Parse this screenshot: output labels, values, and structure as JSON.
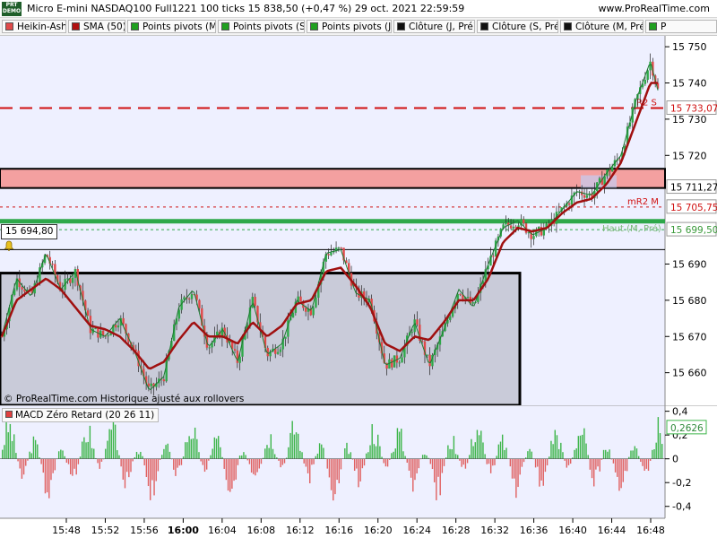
{
  "header": {
    "badge_line1": "PRT",
    "badge_line2": "DEMO",
    "title": "Micro E-mini NASDAQ100 Full1221 100 ticks 15 838,50 (+0,47 %) 29 oct. 2021 22:59:59",
    "site": "www.ProRealTime.com"
  },
  "legend": [
    {
      "label": "Heikin-Ashi",
      "color": "#e04a4a"
    },
    {
      "label": "SMA (50)",
      "color": "#b01010"
    },
    {
      "label": "Points pivots (M)",
      "color": "#20a020"
    },
    {
      "label": "Points pivots (S)",
      "color": "#20a020"
    },
    {
      "label": "Points pivots (J)",
      "color": "#20a020"
    },
    {
      "label": "Clôture (J, Pré)",
      "color": "#111111"
    },
    {
      "label": "Clôture (S, Pré)",
      "color": "#111111"
    },
    {
      "label": "Clôture (M, Pré)",
      "color": "#111111"
    },
    {
      "label": "P",
      "color": "#20a020"
    }
  ],
  "notes": {
    "copyright": "© ProRealTime.com  Historique ajusté aux rollovers",
    "left_price": "15 694,80"
  },
  "price_labels": {
    "r2s": {
      "text": "15 733,07",
      "level": 15733.07,
      "tag": "R2 S"
    },
    "upper_zone": {
      "text": "15 711,27",
      "level": 15711.27
    },
    "mr2m": {
      "text": "15 705,75",
      "level": 15705.75,
      "tag": "mR2 M"
    },
    "haut": {
      "text": "15 699,50",
      "level": 15699.5,
      "tag": "Haut (M, Pré)"
    },
    "last": {
      "text": "15 740",
      "level": 15740
    }
  },
  "macd": {
    "legend": "MACD Zéro Retard (20 26 11)",
    "value_label": "0,2626",
    "value": 0.2626
  },
  "colors": {
    "bull": "#2fa84a",
    "bear": "#e04848",
    "sma": "#a01010",
    "zone_fill": "#c9cbd9",
    "red_zone": "#f4a0a0",
    "pivot_green": "#2ea84a",
    "macd_pos": "#3db54a",
    "macd_neg": "#e06060",
    "bg": "#eef0ff"
  },
  "chart_data": {
    "type": "line",
    "title": "Micro E-mini NASDAQ100 Full1221 100 ticks",
    "y_ticks": [
      {
        "label": "15 750",
        "value": 15750
      },
      {
        "label": "15 740",
        "value": 15740
      },
      {
        "label": "15 730",
        "value": 15730
      },
      {
        "label": "15 720",
        "value": 15720
      },
      {
        "label": "15 690",
        "value": 15690
      },
      {
        "label": "15 680",
        "value": 15680
      },
      {
        "label": "15 670",
        "value": 15670
      },
      {
        "label": "15 660",
        "value": 15660
      }
    ],
    "x_ticks": [
      "15:48",
      "15:52",
      "15:56",
      "16:00",
      "16:04",
      "16:08",
      "16:12",
      "16:16",
      "16:20",
      "16:24",
      "16:28",
      "16:32",
      "16:36",
      "16:40",
      "16:44",
      "16:48"
    ],
    "macd_ticks": [
      {
        "label": "0,4",
        "value": 0.4
      },
      {
        "label": "0,2",
        "value": 0.2
      },
      {
        "label": "0",
        "value": 0
      },
      {
        "label": "-0,2",
        "value": -0.2
      },
      {
        "label": "-0,4",
        "value": -0.4
      }
    ],
    "ylim": [
      15651,
      15753
    ],
    "macd_ylim": [
      -0.5,
      0.45
    ],
    "price_path": [
      [
        0,
        15670
      ],
      [
        2,
        15686
      ],
      [
        4,
        15681
      ],
      [
        6,
        15693
      ],
      [
        8,
        15683
      ],
      [
        10,
        15688
      ],
      [
        12,
        15672
      ],
      [
        14,
        15670
      ],
      [
        16,
        15675
      ],
      [
        18,
        15666
      ],
      [
        20,
        15655
      ],
      [
        22,
        15659
      ],
      [
        24,
        15678
      ],
      [
        26,
        15683
      ],
      [
        28,
        15667
      ],
      [
        30,
        15672
      ],
      [
        32,
        15663
      ],
      [
        34,
        15680
      ],
      [
        36,
        15665
      ],
      [
        38,
        15668
      ],
      [
        40,
        15680
      ],
      [
        42,
        15677
      ],
      [
        44,
        15693
      ],
      [
        46,
        15694
      ],
      [
        48,
        15682
      ],
      [
        50,
        15680
      ],
      [
        52,
        15662
      ],
      [
        54,
        15664
      ],
      [
        56,
        15674
      ],
      [
        58,
        15662
      ],
      [
        60,
        15672
      ],
      [
        62,
        15683
      ],
      [
        64,
        15678
      ],
      [
        66,
        15690
      ],
      [
        68,
        15700
      ],
      [
        70,
        15702
      ],
      [
        72,
        15698
      ],
      [
        74,
        15700
      ],
      [
        76,
        15705
      ],
      [
        78,
        15710
      ],
      [
        80,
        15709
      ],
      [
        82,
        15715
      ],
      [
        84,
        15720
      ],
      [
        86,
        15735
      ],
      [
        88,
        15746
      ],
      [
        89,
        15738
      ]
    ],
    "sma_path": [
      [
        0,
        15670
      ],
      [
        2,
        15680
      ],
      [
        4,
        15683
      ],
      [
        6,
        15686
      ],
      [
        8,
        15683
      ],
      [
        10,
        15678
      ],
      [
        12,
        15673
      ],
      [
        14,
        15672
      ],
      [
        16,
        15670
      ],
      [
        18,
        15666
      ],
      [
        20,
        15661
      ],
      [
        22,
        15663
      ],
      [
        24,
        15669
      ],
      [
        26,
        15674
      ],
      [
        28,
        15670
      ],
      [
        30,
        15670
      ],
      [
        32,
        15668
      ],
      [
        34,
        15674
      ],
      [
        36,
        15670
      ],
      [
        38,
        15673
      ],
      [
        40,
        15679
      ],
      [
        42,
        15680
      ],
      [
        44,
        15688
      ],
      [
        46,
        15689
      ],
      [
        48,
        15684
      ],
      [
        50,
        15678
      ],
      [
        52,
        15668
      ],
      [
        54,
        15666
      ],
      [
        56,
        15670
      ],
      [
        58,
        15669
      ],
      [
        60,
        15674
      ],
      [
        62,
        15680
      ],
      [
        64,
        15680
      ],
      [
        66,
        15686
      ],
      [
        68,
        15696
      ],
      [
        70,
        15700
      ],
      [
        72,
        15699
      ],
      [
        74,
        15700
      ],
      [
        76,
        15704
      ],
      [
        78,
        15707
      ],
      [
        80,
        15708
      ],
      [
        82,
        15712
      ],
      [
        84,
        15718
      ],
      [
        86,
        15729
      ],
      [
        88,
        15740
      ],
      [
        89,
        15740
      ]
    ]
  }
}
